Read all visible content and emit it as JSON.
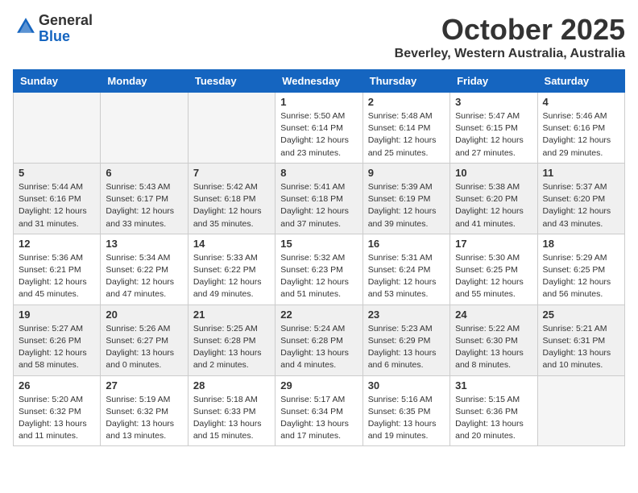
{
  "header": {
    "logo_line1": "General",
    "logo_line2": "Blue",
    "month": "October 2025",
    "location": "Beverley, Western Australia, Australia"
  },
  "weekdays": [
    "Sunday",
    "Monday",
    "Tuesday",
    "Wednesday",
    "Thursday",
    "Friday",
    "Saturday"
  ],
  "weeks": [
    [
      {
        "day": "",
        "info": ""
      },
      {
        "day": "",
        "info": ""
      },
      {
        "day": "",
        "info": ""
      },
      {
        "day": "1",
        "info": "Sunrise: 5:50 AM\nSunset: 6:14 PM\nDaylight: 12 hours\nand 23 minutes."
      },
      {
        "day": "2",
        "info": "Sunrise: 5:48 AM\nSunset: 6:14 PM\nDaylight: 12 hours\nand 25 minutes."
      },
      {
        "day": "3",
        "info": "Sunrise: 5:47 AM\nSunset: 6:15 PM\nDaylight: 12 hours\nand 27 minutes."
      },
      {
        "day": "4",
        "info": "Sunrise: 5:46 AM\nSunset: 6:16 PM\nDaylight: 12 hours\nand 29 minutes."
      }
    ],
    [
      {
        "day": "5",
        "info": "Sunrise: 5:44 AM\nSunset: 6:16 PM\nDaylight: 12 hours\nand 31 minutes."
      },
      {
        "day": "6",
        "info": "Sunrise: 5:43 AM\nSunset: 6:17 PM\nDaylight: 12 hours\nand 33 minutes."
      },
      {
        "day": "7",
        "info": "Sunrise: 5:42 AM\nSunset: 6:18 PM\nDaylight: 12 hours\nand 35 minutes."
      },
      {
        "day": "8",
        "info": "Sunrise: 5:41 AM\nSunset: 6:18 PM\nDaylight: 12 hours\nand 37 minutes."
      },
      {
        "day": "9",
        "info": "Sunrise: 5:39 AM\nSunset: 6:19 PM\nDaylight: 12 hours\nand 39 minutes."
      },
      {
        "day": "10",
        "info": "Sunrise: 5:38 AM\nSunset: 6:20 PM\nDaylight: 12 hours\nand 41 minutes."
      },
      {
        "day": "11",
        "info": "Sunrise: 5:37 AM\nSunset: 6:20 PM\nDaylight: 12 hours\nand 43 minutes."
      }
    ],
    [
      {
        "day": "12",
        "info": "Sunrise: 5:36 AM\nSunset: 6:21 PM\nDaylight: 12 hours\nand 45 minutes."
      },
      {
        "day": "13",
        "info": "Sunrise: 5:34 AM\nSunset: 6:22 PM\nDaylight: 12 hours\nand 47 minutes."
      },
      {
        "day": "14",
        "info": "Sunrise: 5:33 AM\nSunset: 6:22 PM\nDaylight: 12 hours\nand 49 minutes."
      },
      {
        "day": "15",
        "info": "Sunrise: 5:32 AM\nSunset: 6:23 PM\nDaylight: 12 hours\nand 51 minutes."
      },
      {
        "day": "16",
        "info": "Sunrise: 5:31 AM\nSunset: 6:24 PM\nDaylight: 12 hours\nand 53 minutes."
      },
      {
        "day": "17",
        "info": "Sunrise: 5:30 AM\nSunset: 6:25 PM\nDaylight: 12 hours\nand 55 minutes."
      },
      {
        "day": "18",
        "info": "Sunrise: 5:29 AM\nSunset: 6:25 PM\nDaylight: 12 hours\nand 56 minutes."
      }
    ],
    [
      {
        "day": "19",
        "info": "Sunrise: 5:27 AM\nSunset: 6:26 PM\nDaylight: 12 hours\nand 58 minutes."
      },
      {
        "day": "20",
        "info": "Sunrise: 5:26 AM\nSunset: 6:27 PM\nDaylight: 13 hours\nand 0 minutes."
      },
      {
        "day": "21",
        "info": "Sunrise: 5:25 AM\nSunset: 6:28 PM\nDaylight: 13 hours\nand 2 minutes."
      },
      {
        "day": "22",
        "info": "Sunrise: 5:24 AM\nSunset: 6:28 PM\nDaylight: 13 hours\nand 4 minutes."
      },
      {
        "day": "23",
        "info": "Sunrise: 5:23 AM\nSunset: 6:29 PM\nDaylight: 13 hours\nand 6 minutes."
      },
      {
        "day": "24",
        "info": "Sunrise: 5:22 AM\nSunset: 6:30 PM\nDaylight: 13 hours\nand 8 minutes."
      },
      {
        "day": "25",
        "info": "Sunrise: 5:21 AM\nSunset: 6:31 PM\nDaylight: 13 hours\nand 10 minutes."
      }
    ],
    [
      {
        "day": "26",
        "info": "Sunrise: 5:20 AM\nSunset: 6:32 PM\nDaylight: 13 hours\nand 11 minutes."
      },
      {
        "day": "27",
        "info": "Sunrise: 5:19 AM\nSunset: 6:32 PM\nDaylight: 13 hours\nand 13 minutes."
      },
      {
        "day": "28",
        "info": "Sunrise: 5:18 AM\nSunset: 6:33 PM\nDaylight: 13 hours\nand 15 minutes."
      },
      {
        "day": "29",
        "info": "Sunrise: 5:17 AM\nSunset: 6:34 PM\nDaylight: 13 hours\nand 17 minutes."
      },
      {
        "day": "30",
        "info": "Sunrise: 5:16 AM\nSunset: 6:35 PM\nDaylight: 13 hours\nand 19 minutes."
      },
      {
        "day": "31",
        "info": "Sunrise: 5:15 AM\nSunset: 6:36 PM\nDaylight: 13 hours\nand 20 minutes."
      },
      {
        "day": "",
        "info": ""
      }
    ]
  ]
}
